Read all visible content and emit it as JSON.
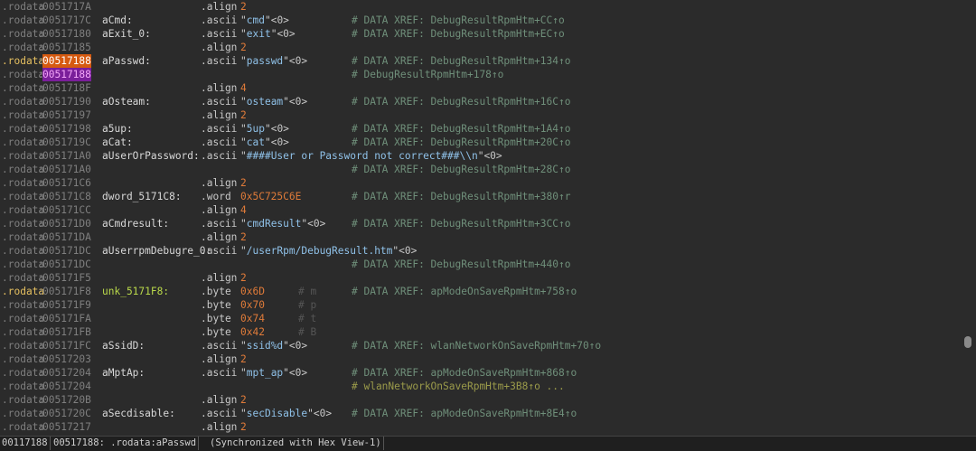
{
  "listing": [
    {
      "seg": ".rodata",
      "addr": "0051717A",
      "label": "",
      "mnem": ".align",
      "op": [
        {
          "t": "2",
          "k": "num"
        }
      ],
      "cmt": ""
    },
    {
      "seg": ".rodata",
      "addr": "0051717C",
      "label": "aCmd:",
      "mnem": ".ascii",
      "op": [
        {
          "t": "\"",
          "k": "w"
        },
        {
          "t": "cmd",
          "k": "str"
        },
        {
          "t": "\"<0>",
          "k": "w"
        }
      ],
      "cmt": "# DATA XREF: DebugResultRpmHtm+CC↑o"
    },
    {
      "seg": ".rodata",
      "addr": "00517180",
      "label": "aExit_0:",
      "mnem": ".ascii",
      "op": [
        {
          "t": "\"",
          "k": "w"
        },
        {
          "t": "exit",
          "k": "str"
        },
        {
          "t": "\"<0>",
          "k": "w"
        }
      ],
      "cmt": "# DATA XREF: DebugResultRpmHtm+EC↑o"
    },
    {
      "seg": ".rodata",
      "addr": "00517185",
      "label": "",
      "mnem": ".align",
      "op": [
        {
          "t": "2",
          "k": "num"
        }
      ],
      "cmt": ""
    },
    {
      "seg": ".rodata",
      "addr": "00517188",
      "label": "aPasswd:",
      "mnem": ".ascii",
      "op": [
        {
          "t": "\"",
          "k": "w"
        },
        {
          "t": "passwd",
          "k": "str"
        },
        {
          "t": "\"<0>",
          "k": "w"
        }
      ],
      "cmt": "# DATA XREF: DebugResultRpmHtm+134↑o",
      "cur": true
    },
    {
      "seg": ".rodata",
      "addr": "00517188",
      "label": "",
      "mnem": "",
      "op": [],
      "cmt": "# DebugResultRpmHtm+178↑o",
      "sel": true
    },
    {
      "seg": ".rodata",
      "addr": "0051718F",
      "label": "",
      "mnem": ".align",
      "op": [
        {
          "t": "4",
          "k": "num"
        }
      ],
      "cmt": ""
    },
    {
      "seg": ".rodata",
      "addr": "00517190",
      "label": "aOsteam:",
      "mnem": ".ascii",
      "op": [
        {
          "t": "\"",
          "k": "w"
        },
        {
          "t": "osteam",
          "k": "str"
        },
        {
          "t": "\"<0>",
          "k": "w"
        }
      ],
      "cmt": "# DATA XREF: DebugResultRpmHtm+16C↑o"
    },
    {
      "seg": ".rodata",
      "addr": "00517197",
      "label": "",
      "mnem": ".align",
      "op": [
        {
          "t": "2",
          "k": "num"
        }
      ],
      "cmt": ""
    },
    {
      "seg": ".rodata",
      "addr": "00517198",
      "label": "a5up:",
      "mnem": ".ascii",
      "op": [
        {
          "t": "\"",
          "k": "w"
        },
        {
          "t": "5up",
          "k": "str"
        },
        {
          "t": "\"<0>",
          "k": "w"
        }
      ],
      "cmt": "# DATA XREF: DebugResultRpmHtm+1A4↑o"
    },
    {
      "seg": ".rodata",
      "addr": "0051719C",
      "label": "aCat:",
      "mnem": ".ascii",
      "op": [
        {
          "t": "\"",
          "k": "w"
        },
        {
          "t": "cat",
          "k": "str"
        },
        {
          "t": "\"<0>",
          "k": "w"
        }
      ],
      "cmt": "# DATA XREF: DebugResultRpmHtm+20C↑o"
    },
    {
      "seg": ".rodata",
      "addr": "005171A0",
      "label": "aUserOrPassword:",
      "mnem": ".ascii",
      "op": [
        {
          "t": "\"",
          "k": "w"
        },
        {
          "t": "####User or Password not correct###\\\\n",
          "k": "str"
        },
        {
          "t": "\"<0>",
          "k": "w"
        }
      ],
      "cmt": ""
    },
    {
      "seg": ".rodata",
      "addr": "005171A0",
      "label": "",
      "mnem": "",
      "op": [],
      "cmt": "# DATA XREF: DebugResultRpmHtm+28C↑o"
    },
    {
      "seg": ".rodata",
      "addr": "005171C6",
      "label": "",
      "mnem": ".align",
      "op": [
        {
          "t": "2",
          "k": "num"
        }
      ],
      "cmt": ""
    },
    {
      "seg": ".rodata",
      "addr": "005171C8",
      "label": "dword_5171C8:",
      "mnem": ".word",
      "op": [
        {
          "t": "0x5C725C6E",
          "k": "num"
        }
      ],
      "cmt": "# DATA XREF: DebugResultRpmHtm+380↑r"
    },
    {
      "seg": ".rodata",
      "addr": "005171CC",
      "label": "",
      "mnem": ".align",
      "op": [
        {
          "t": "4",
          "k": "num"
        }
      ],
      "cmt": ""
    },
    {
      "seg": ".rodata",
      "addr": "005171D0",
      "label": "aCmdresult:",
      "mnem": ".ascii",
      "op": [
        {
          "t": "\"",
          "k": "w"
        },
        {
          "t": "cmdResult",
          "k": "str"
        },
        {
          "t": "\"<0>",
          "k": "w"
        }
      ],
      "cmt": "# DATA XREF: DebugResultRpmHtm+3CC↑o"
    },
    {
      "seg": ".rodata",
      "addr": "005171DA",
      "label": "",
      "mnem": ".align",
      "op": [
        {
          "t": "2",
          "k": "num"
        }
      ],
      "cmt": ""
    },
    {
      "seg": ".rodata",
      "addr": "005171DC",
      "label": "aUserrpmDebugre_0:",
      "mnem": ".ascii",
      "op": [
        {
          "t": "\"",
          "k": "w"
        },
        {
          "t": "/userRpm/DebugResult.htm",
          "k": "str"
        },
        {
          "t": "\"<0>",
          "k": "w"
        }
      ],
      "cmt": ""
    },
    {
      "seg": ".rodata",
      "addr": "005171DC",
      "label": "",
      "mnem": "",
      "op": [],
      "cmt": "# DATA XREF: DebugResultRpmHtm+440↑o"
    },
    {
      "seg": ".rodata",
      "addr": "005171F5",
      "label": "",
      "mnem": ".align",
      "op": [
        {
          "t": "2",
          "k": "num"
        }
      ],
      "cmt": ""
    },
    {
      "seg": ".rodata",
      "addr": "005171F8",
      "label": "unk_5171F8:",
      "mnem": ".byte",
      "op": [
        {
          "t": "0x6D",
          "k": "num"
        }
      ],
      "cmt": "# m",
      "cmt2": "# DATA XREF: apModeOnSaveRpmHtm+758↑o",
      "hl": true
    },
    {
      "seg": ".rodata",
      "addr": "005171F9",
      "label": "",
      "mnem": ".byte",
      "op": [
        {
          "t": "0x70",
          "k": "num"
        }
      ],
      "cmt": "# p"
    },
    {
      "seg": ".rodata",
      "addr": "005171FA",
      "label": "",
      "mnem": ".byte",
      "op": [
        {
          "t": "0x74",
          "k": "num"
        }
      ],
      "cmt": "# t"
    },
    {
      "seg": ".rodata",
      "addr": "005171FB",
      "label": "",
      "mnem": ".byte",
      "op": [
        {
          "t": "0x42",
          "k": "num"
        }
      ],
      "cmt": "# B"
    },
    {
      "seg": ".rodata",
      "addr": "005171FC",
      "label": "aSsidD:",
      "mnem": ".ascii",
      "op": [
        {
          "t": "\"",
          "k": "w"
        },
        {
          "t": "ssid%d",
          "k": "str"
        },
        {
          "t": "\"<0>",
          "k": "w"
        }
      ],
      "cmt": "# DATA XREF: wlanNetworkOnSaveRpmHtm+70↑o"
    },
    {
      "seg": ".rodata",
      "addr": "00517203",
      "label": "",
      "mnem": ".align",
      "op": [
        {
          "t": "2",
          "k": "num"
        }
      ],
      "cmt": ""
    },
    {
      "seg": ".rodata",
      "addr": "00517204",
      "label": "aMptAp:",
      "mnem": ".ascii",
      "op": [
        {
          "t": "\"",
          "k": "w"
        },
        {
          "t": "mpt_ap",
          "k": "str"
        },
        {
          "t": "\"<0>",
          "k": "w"
        }
      ],
      "cmt": "# DATA XREF: apModeOnSaveRpmHtm+868↑o"
    },
    {
      "seg": ".rodata",
      "addr": "00517204",
      "label": "",
      "mnem": "",
      "op": [],
      "cmt": "# wlanNetworkOnSaveRpmHtm+3B8↑o ...",
      "cy": true
    },
    {
      "seg": ".rodata",
      "addr": "0051720B",
      "label": "",
      "mnem": ".align",
      "op": [
        {
          "t": "2",
          "k": "num"
        }
      ],
      "cmt": ""
    },
    {
      "seg": ".rodata",
      "addr": "0051720C",
      "label": "aSecdisable:",
      "mnem": ".ascii",
      "op": [
        {
          "t": "\"",
          "k": "w"
        },
        {
          "t": "secDisable",
          "k": "str"
        },
        {
          "t": "\"<0>",
          "k": "w"
        }
      ],
      "cmt": "# DATA XREF: apModeOnSaveRpmHtm+8E4↑o"
    },
    {
      "seg": ".rodata",
      "addr": "00517217",
      "label": "",
      "mnem": ".align",
      "op": [
        {
          "t": "2",
          "k": "num"
        }
      ],
      "cmt": ""
    }
  ],
  "status": {
    "offset": "00117188",
    "location": "00517188: .rodata:aPasswd",
    "sync": "(Synchronized with Hex View-1)"
  }
}
